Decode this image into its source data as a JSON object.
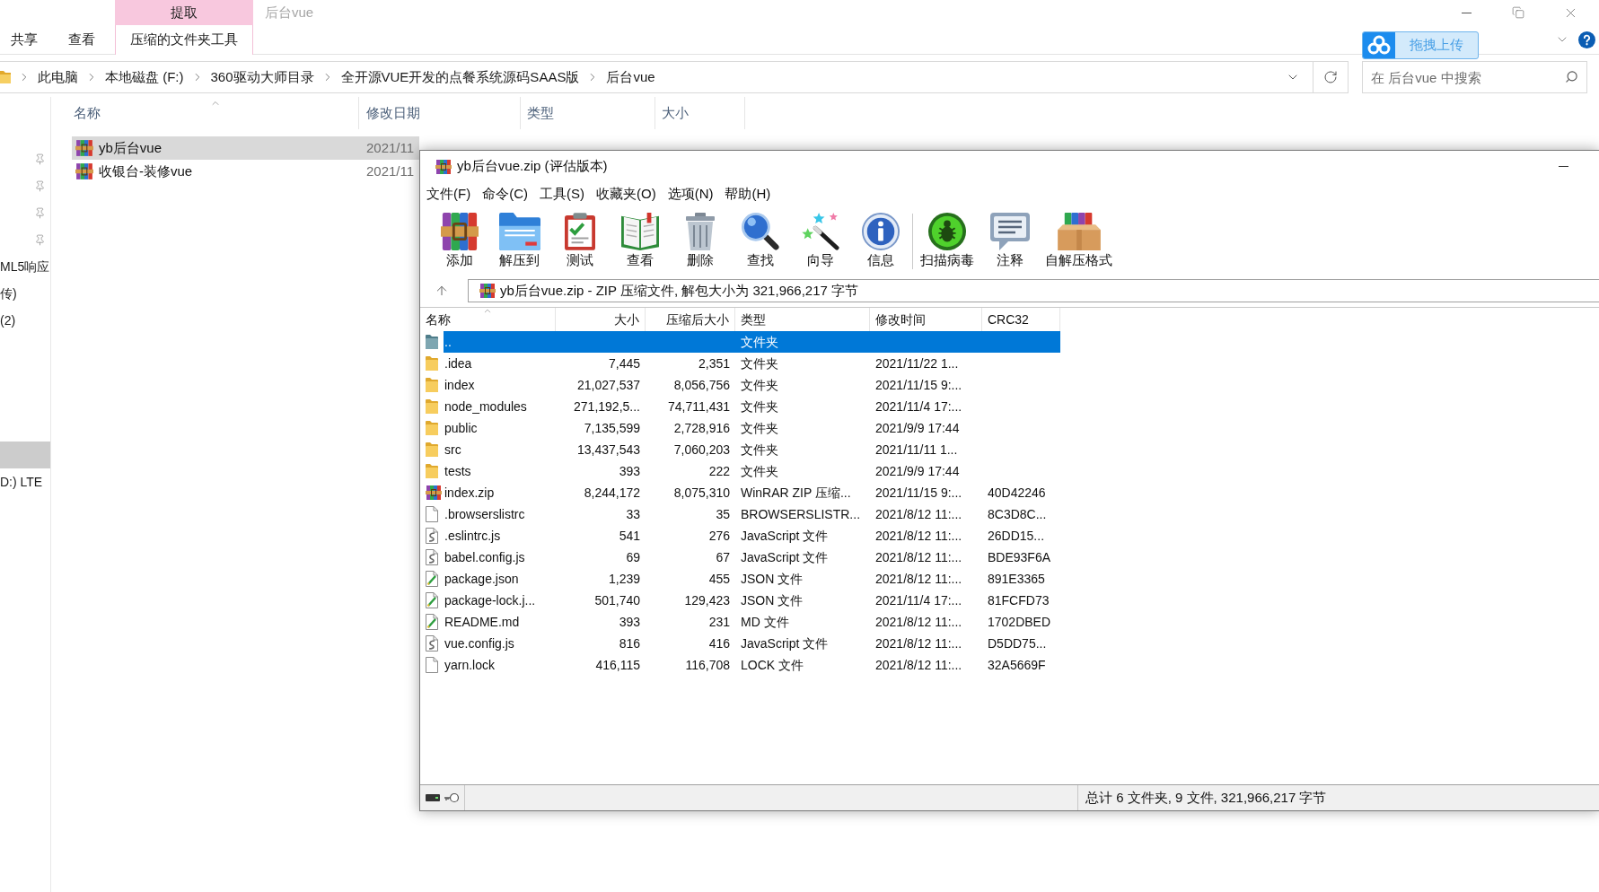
{
  "explorer": {
    "ribbon": {
      "context_label": "提取",
      "window_title": "后台vue",
      "tabs": [
        {
          "label": "共享",
          "selected": false
        },
        {
          "label": "查看",
          "selected": false
        },
        {
          "label": "压缩的文件夹工具",
          "selected": true
        }
      ]
    },
    "upload_button": {
      "label": "拖拽上传"
    },
    "address": {
      "crumbs": [
        "此电脑",
        "本地磁盘 (F:)",
        "360驱动大师目录",
        "全开源VUE开发的点餐系统源码SAAS版",
        "后台vue"
      ]
    },
    "search": {
      "placeholder": "在 后台vue 中搜索"
    },
    "nav_sections": [
      {
        "items": [
          {
            "pinned": true,
            "selected": false
          },
          {
            "pinned": true,
            "selected": false
          },
          {
            "pinned": true,
            "selected": false
          },
          {
            "pinned": true,
            "selected": false
          },
          {
            "label": "ML5响应",
            "pinned": false,
            "selected": false
          },
          {
            "label": "传)",
            "pinned": false,
            "selected": false
          },
          {
            "label": "(2)",
            "pinned": false,
            "selected": false
          }
        ]
      },
      {
        "items": [
          {
            "pinned": false,
            "selected": true
          },
          {
            "label": "D:) LTE",
            "pinned": false,
            "selected": false
          }
        ]
      }
    ],
    "columns": [
      {
        "label": "名称",
        "sorted": true
      },
      {
        "label": "修改日期",
        "sorted": false
      },
      {
        "label": "类型",
        "sorted": false
      },
      {
        "label": "大小",
        "sorted": false
      }
    ],
    "files": [
      {
        "name": "yb后台vue",
        "date": "2021/11",
        "selected": true
      },
      {
        "name": "收银台-装修vue",
        "date": "2021/11",
        "selected": false
      }
    ]
  },
  "archive": {
    "title": "yb后台vue.zip (评估版本)",
    "menu": [
      "文件(F)",
      "命令(C)",
      "工具(S)",
      "收藏夹(O)",
      "选项(N)",
      "帮助(H)"
    ],
    "toolbar_groups": [
      [
        {
          "kind": "add",
          "label": "添加"
        },
        {
          "kind": "extract",
          "label": "解压到"
        },
        {
          "kind": "test",
          "label": "测试"
        },
        {
          "kind": "view",
          "label": "查看"
        },
        {
          "kind": "delete",
          "label": "删除"
        },
        {
          "kind": "find",
          "label": "查找"
        },
        {
          "kind": "wizard",
          "label": "向导"
        },
        {
          "kind": "info",
          "label": "信息"
        }
      ],
      [
        {
          "kind": "scan",
          "label": "扫描病毒"
        },
        {
          "kind": "comment",
          "label": "注释"
        },
        {
          "kind": "sfx",
          "label": "自解压格式"
        }
      ]
    ],
    "path": "yb后台vue.zip - ZIP 压缩文件, 解包大小为 321,966,217 字节",
    "columns": [
      {
        "label": "名称",
        "sorted": true
      },
      {
        "label": "大小",
        "sorted": false
      },
      {
        "label": "压缩后大小",
        "sorted": false
      },
      {
        "label": "类型",
        "sorted": false
      },
      {
        "label": "修改时间",
        "sorted": false
      },
      {
        "label": "CRC32",
        "sorted": false
      }
    ],
    "rows": [
      {
        "kind": "parent",
        "name": "..",
        "type": "文件夹",
        "selected": true
      },
      {
        "kind": "folder",
        "name": ".idea",
        "size": "7,445",
        "packed": "2,351",
        "type": "文件夹",
        "modified": "2021/11/22 1...",
        "selected": false
      },
      {
        "kind": "folder",
        "name": "index",
        "size": "21,027,537",
        "packed": "8,056,756",
        "type": "文件夹",
        "modified": "2021/11/15 9:...",
        "selected": false
      },
      {
        "kind": "folder",
        "name": "node_modules",
        "size": "271,192,5...",
        "packed": "74,711,431",
        "type": "文件夹",
        "modified": "2021/11/4 17:...",
        "selected": false
      },
      {
        "kind": "folder",
        "name": "public",
        "size": "7,135,599",
        "packed": "2,728,916",
        "type": "文件夹",
        "modified": "2021/9/9 17:44",
        "selected": false
      },
      {
        "kind": "folder",
        "name": "src",
        "size": "13,437,543",
        "packed": "7,060,203",
        "type": "文件夹",
        "modified": "2021/11/11 1...",
        "selected": false
      },
      {
        "kind": "folder",
        "name": "tests",
        "size": "393",
        "packed": "222",
        "type": "文件夹",
        "modified": "2021/9/9 17:44",
        "selected": false
      },
      {
        "kind": "archive",
        "name": "index.zip",
        "size": "8,244,172",
        "packed": "8,075,310",
        "type": "WinRAR ZIP 压缩...",
        "modified": "2021/11/15 9:...",
        "crc": "40D42246",
        "selected": false
      },
      {
        "kind": "file",
        "name": ".browserslistrc",
        "size": "33",
        "packed": "35",
        "type": "BROWSERSLISTR...",
        "modified": "2021/8/12 11:...",
        "crc": "8C3D8C...",
        "selected": false
      },
      {
        "kind": "script",
        "name": ".eslintrc.js",
        "size": "541",
        "packed": "276",
        "type": "JavaScript 文件",
        "modified": "2021/8/12 11:...",
        "crc": "26DD15...",
        "selected": false
      },
      {
        "kind": "script",
        "name": "babel.config.js",
        "size": "69",
        "packed": "67",
        "type": "JavaScript 文件",
        "modified": "2021/8/12 11:...",
        "crc": "BDE93F6A",
        "selected": false
      },
      {
        "kind": "document",
        "name": "package.json",
        "size": "1,239",
        "packed": "455",
        "type": "JSON 文件",
        "modified": "2021/8/12 11:...",
        "crc": "891E3365",
        "selected": false
      },
      {
        "kind": "document",
        "name": "package-lock.j...",
        "size": "501,740",
        "packed": "129,423",
        "type": "JSON 文件",
        "modified": "2021/11/4 17:...",
        "crc": "81FCFD73",
        "selected": false
      },
      {
        "kind": "document",
        "name": "README.md",
        "size": "393",
        "packed": "231",
        "type": "MD 文件",
        "modified": "2021/8/12 11:...",
        "crc": "1702DBED",
        "selected": false
      },
      {
        "kind": "script",
        "name": "vue.config.js",
        "size": "816",
        "packed": "416",
        "type": "JavaScript 文件",
        "modified": "2021/8/12 11:...",
        "crc": "D5DD75...",
        "selected": false
      },
      {
        "kind": "file",
        "name": "yarn.lock",
        "size": "416,115",
        "packed": "116,708",
        "type": "LOCK 文件",
        "modified": "2021/8/12 11:...",
        "crc": "32A5669F",
        "selected": false
      }
    ],
    "status": "总计 6 文件夹, 9 文件, 321,966,217 字节"
  }
}
